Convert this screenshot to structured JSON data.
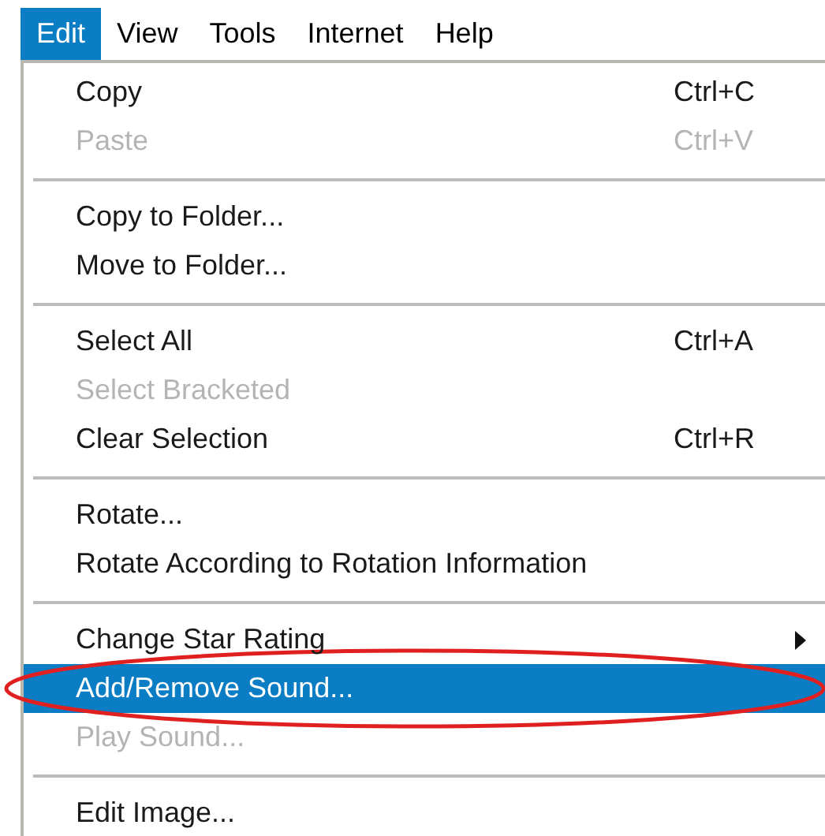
{
  "menubar": [
    {
      "label": "Edit",
      "selected": true
    },
    {
      "label": "View",
      "selected": false
    },
    {
      "label": "Tools",
      "selected": false
    },
    {
      "label": "Internet",
      "selected": false
    },
    {
      "label": "Help",
      "selected": false
    }
  ],
  "menu": {
    "items": [
      {
        "kind": "item",
        "label": "Copy",
        "shortcut": "Ctrl+C",
        "disabled": false,
        "selected": false
      },
      {
        "kind": "item",
        "label": "Paste",
        "shortcut": "Ctrl+V",
        "disabled": true,
        "selected": false
      },
      {
        "kind": "separator"
      },
      {
        "kind": "item",
        "label": "Copy to Folder...",
        "disabled": false,
        "selected": false
      },
      {
        "kind": "item",
        "label": "Move to Folder...",
        "disabled": false,
        "selected": false
      },
      {
        "kind": "separator"
      },
      {
        "kind": "item",
        "label": "Select All",
        "shortcut": "Ctrl+A",
        "disabled": false,
        "selected": false
      },
      {
        "kind": "item",
        "label": "Select Bracketed",
        "disabled": true,
        "selected": false
      },
      {
        "kind": "item",
        "label": "Clear Selection",
        "shortcut": "Ctrl+R",
        "disabled": false,
        "selected": false
      },
      {
        "kind": "separator"
      },
      {
        "kind": "item",
        "label": "Rotate...",
        "disabled": false,
        "selected": false
      },
      {
        "kind": "item",
        "label": "Rotate According to Rotation Information",
        "disabled": false,
        "selected": false
      },
      {
        "kind": "separator"
      },
      {
        "kind": "item",
        "label": "Change Star Rating",
        "disabled": false,
        "selected": false,
        "submenu": true
      },
      {
        "kind": "item",
        "label": "Add/Remove Sound...",
        "disabled": false,
        "selected": true,
        "circled": true
      },
      {
        "kind": "item",
        "label": "Play Sound...",
        "disabled": true,
        "selected": false
      },
      {
        "kind": "separator"
      },
      {
        "kind": "item",
        "label": "Edit Image...",
        "disabled": false,
        "selected": false
      }
    ]
  }
}
